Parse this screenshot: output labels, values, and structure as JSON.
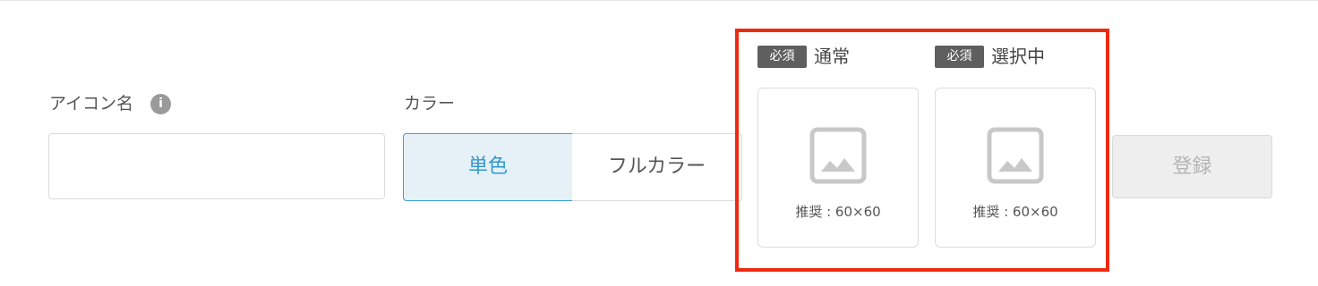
{
  "form": {
    "icon_name": {
      "label": "アイコン名",
      "info_icon": "info-icon",
      "info_glyph": "i",
      "value": "",
      "placeholder": ""
    },
    "color": {
      "label": "カラー",
      "options": [
        {
          "label": "単色",
          "selected": true
        },
        {
          "label": "フルカラー",
          "selected": false
        }
      ]
    },
    "images": {
      "highlight_color": "#ee2a10",
      "items": [
        {
          "badge": "必須",
          "title": "通常",
          "recommendation": "推奨 : 60×60",
          "icon": "image-placeholder-icon"
        },
        {
          "badge": "必須",
          "title": "選択中",
          "recommendation": "推奨 : 60×60",
          "icon": "image-placeholder-icon"
        }
      ]
    },
    "submit": {
      "label": "登録",
      "disabled": true
    }
  },
  "colors": {
    "accent": "#3399cc",
    "accent_border": "#3aa3d8",
    "selected_bg": "#e6f0f7",
    "badge_bg": "#5f5f5f",
    "disabled_bg": "#eeeeee",
    "disabled_text": "#b4b4b4"
  }
}
